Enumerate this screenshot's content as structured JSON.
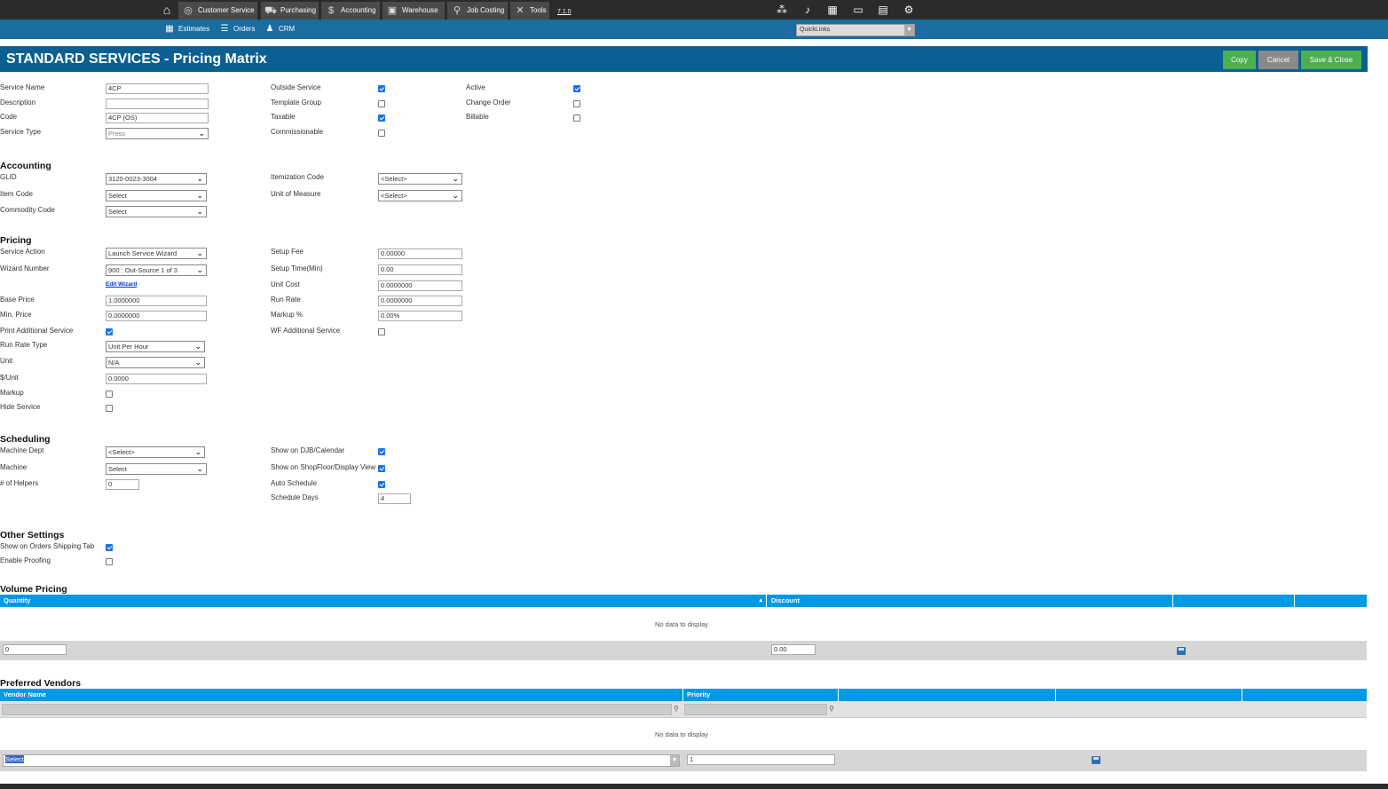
{
  "topnav": {
    "tabs": [
      "Customer Service",
      "Purchasing",
      "Accounting",
      "Warehouse",
      "Job Costing",
      "Tools"
    ],
    "version": "7.1.0"
  },
  "subnav": {
    "items": [
      "Estimates",
      "Orders",
      "CRM"
    ],
    "quicklinks": "QuickLinks"
  },
  "header": {
    "title": "STANDARD SERVICES - Pricing Matrix",
    "copy": "Copy",
    "cancel": "Cancel",
    "save_close": "Save & Close"
  },
  "general": {
    "service_name_label": "Service Name",
    "service_name": "4CP",
    "description_label": "Description",
    "description": "",
    "code_label": "Code",
    "code": "4CP (OS)",
    "service_type_label": "Service Type",
    "service_type": "Press",
    "outside_service_label": "Outside Service",
    "outside_service": true,
    "template_group_label": "Template Group",
    "template_group": false,
    "taxable_label": "Taxable",
    "taxable": true,
    "commissionable_label": "Commissionable",
    "commissionable": false,
    "active_label": "Active",
    "active": true,
    "change_order_label": "Change Order",
    "change_order": false,
    "billable_label": "Billable",
    "billable": false
  },
  "accounting": {
    "heading": "Accounting",
    "glid_label": "GLID",
    "glid": "3120-0023-3004",
    "item_code_label": "Item Code",
    "item_code": "Select",
    "commodity_code_label": "Commodity Code",
    "commodity_code": "Select",
    "itemization_code_label": "Itemization Code",
    "itemization_code": "<Select>",
    "unit_of_measure_label": "Unit of Measure",
    "unit_of_measure": "<Select>"
  },
  "pricing": {
    "heading": "Pricing",
    "service_action_label": "Service Action",
    "service_action": "Launch Service Wizard",
    "wizard_number_label": "Wizard Number",
    "wizard_number": "900 : Out-Source 1 of 3",
    "edit_wizard": "Edit Wizard",
    "base_price_label": "Base Price",
    "base_price": "1.0000000",
    "min_price_label": "Min. Price",
    "min_price": "0.0000000",
    "print_additional_label": "Print Additional Service",
    "print_additional": true,
    "run_rate_type_label": "Run Rate Type",
    "run_rate_type": "Unit Per Hour",
    "unit_label": "Unit",
    "unit": "N/A",
    "per_unit_label": "$/Unit",
    "per_unit": "0.0000",
    "markup_label": "Markup",
    "markup": false,
    "hide_service_label": "Hide Service",
    "hide_service": false,
    "setup_fee_label": "Setup Fee",
    "setup_fee": "0.00000",
    "setup_time_label": "Setup Time(Min)",
    "setup_time": "0.00",
    "unit_cost_label": "Unit Cost",
    "unit_cost": "0.0000000",
    "run_rate_label": "Run Rate",
    "run_rate": "0.0000000",
    "markup_pct_label": "Markup %",
    "markup_pct": "0.00%",
    "wf_additional_label": "WF Additional Service",
    "wf_additional": false
  },
  "scheduling": {
    "heading": "Scheduling",
    "machine_dept_label": "Machine Dept",
    "machine_dept": "<Select>",
    "machine_label": "Machine",
    "machine": "Select",
    "helpers_label": "# of Helpers",
    "helpers": "0",
    "show_djb_label": "Show on DJB/Calendar",
    "show_djb": true,
    "show_shopfloor_label": "Show on ShopFloor/Display View",
    "show_shopfloor": true,
    "auto_schedule_label": "Auto Schedule",
    "auto_schedule": true,
    "schedule_days_label": "Schedule Days",
    "schedule_days": "4"
  },
  "other": {
    "heading": "Other Settings",
    "show_shipping_label": "Show on Orders Shipping Tab",
    "show_shipping": true,
    "enable_proofing_label": "Enable Proofing",
    "enable_proofing": false
  },
  "volume_pricing": {
    "heading": "Volume Pricing",
    "columns": [
      "Quantity",
      "Discount"
    ],
    "empty": "No data to display",
    "new_quantity": "0",
    "new_discount": "0.00"
  },
  "preferred_vendors": {
    "heading": "Preferred Vendors",
    "columns": [
      "Vendor Name",
      "Priority"
    ],
    "empty": "No data to display",
    "new_vendor": "Select",
    "new_priority": "1"
  }
}
